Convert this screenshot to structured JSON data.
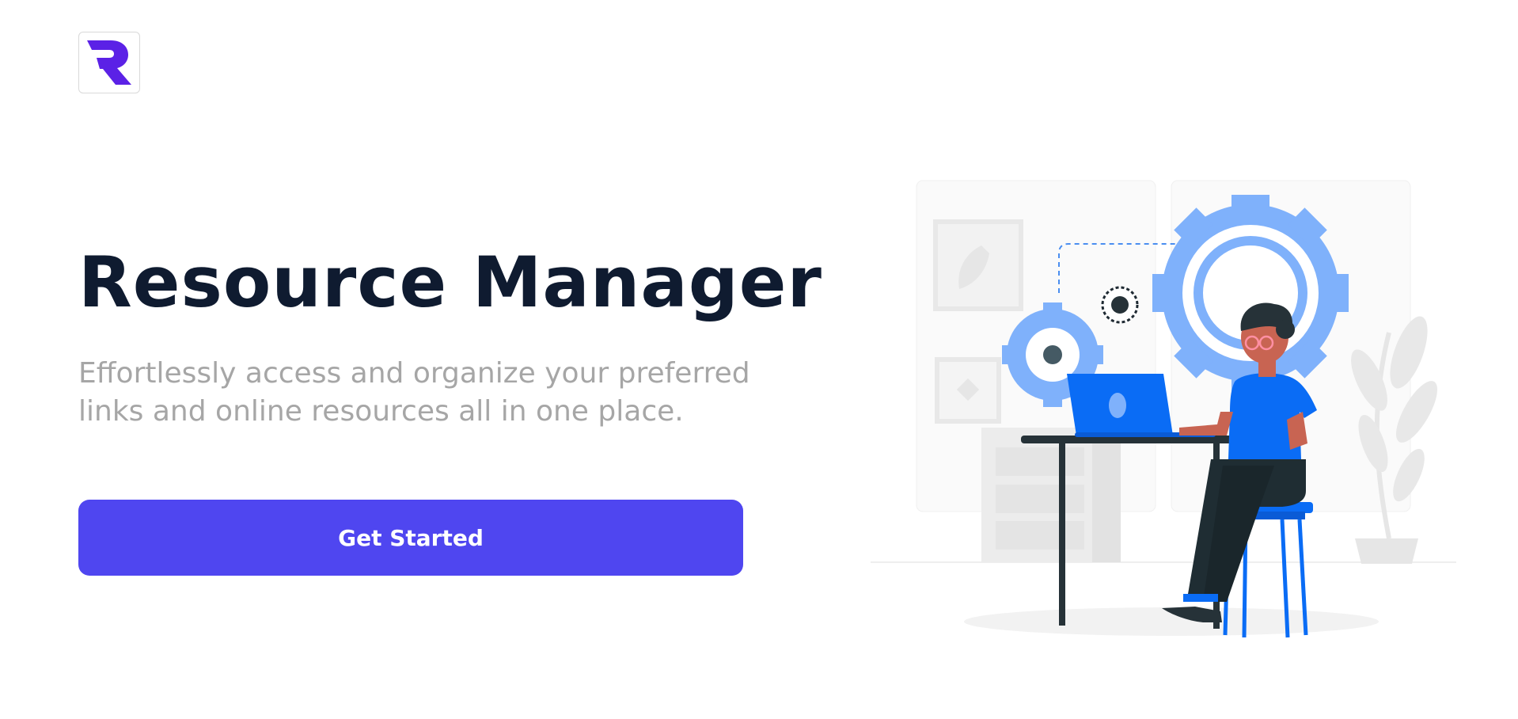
{
  "logo": {
    "icon": "r-logo-icon",
    "color": "#5b21e6"
  },
  "hero": {
    "title": "Resource Manager",
    "subtitle": "Effortlessly access and organize your preferred links and online resources all in one place.",
    "cta_label": "Get Started"
  },
  "colors": {
    "title": "#0f1b30",
    "subtitle": "#a6a6a6",
    "button": "#4f46f0",
    "illustration_primary": "#0a6cf5",
    "illustration_light": "#7fb1fb"
  }
}
